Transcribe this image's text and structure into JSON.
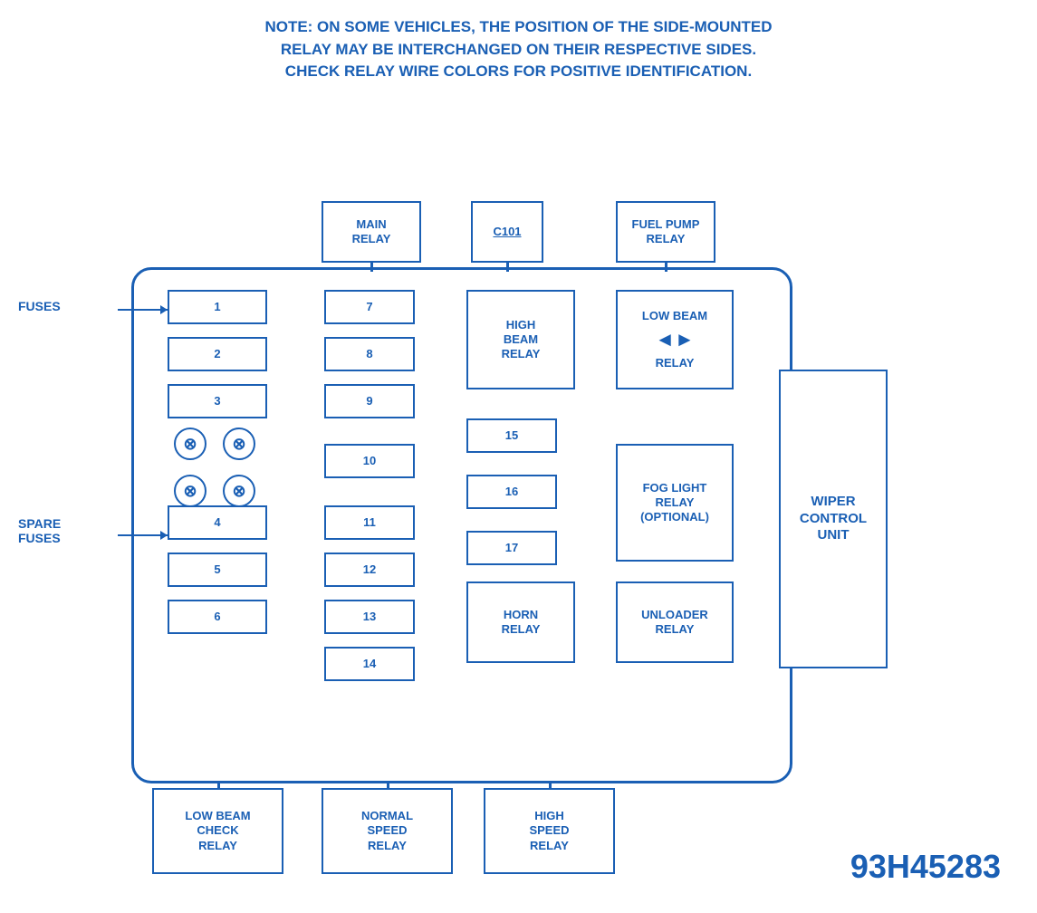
{
  "note": {
    "line1": "NOTE:  ON SOME VEHICLES, THE POSITION OF THE SIDE-MOUNTED",
    "line2": "RELAY MAY BE INTERCHANGED ON THEIR RESPECTIVE SIDES.",
    "line3": "CHECK RELAY WIRE COLORS FOR POSITIVE IDENTIFICATION."
  },
  "top_relays": {
    "main_relay": "MAIN\nRELAY",
    "c101": "C101",
    "fuel_pump": "FUEL PUMP\nRELAY"
  },
  "fuses": {
    "label": "FUSES",
    "spare_label": "SPARE\nFUSES",
    "numbers": [
      "1",
      "2",
      "3",
      "4",
      "5",
      "6",
      "7",
      "8",
      "9",
      "10",
      "11",
      "12",
      "13",
      "14",
      "15",
      "16",
      "17"
    ]
  },
  "internal_relays": {
    "high_beam": "HIGH\nBEAM\nRELAY",
    "low_beam": "LOW BEAM\nRELAY",
    "fog_light": "FOG LIGHT\nRELAY\n(OPTIONAL)",
    "horn": "HORN\nRELAY",
    "unloader": "UNLOADER\nRELAY"
  },
  "wiper_unit": "WIPER\nCONTROL\nUNIT",
  "bottom_relays": {
    "low_beam_check": "LOW BEAM\nCHECK\nRELAY",
    "normal_speed": "NORMAL\nSPEED\nRELAY",
    "high_speed": "HIGH\nSPEED\nRELAY"
  },
  "part_number": "93H45283",
  "colors": {
    "primary": "#1a5fb4",
    "background": "#ffffff"
  }
}
